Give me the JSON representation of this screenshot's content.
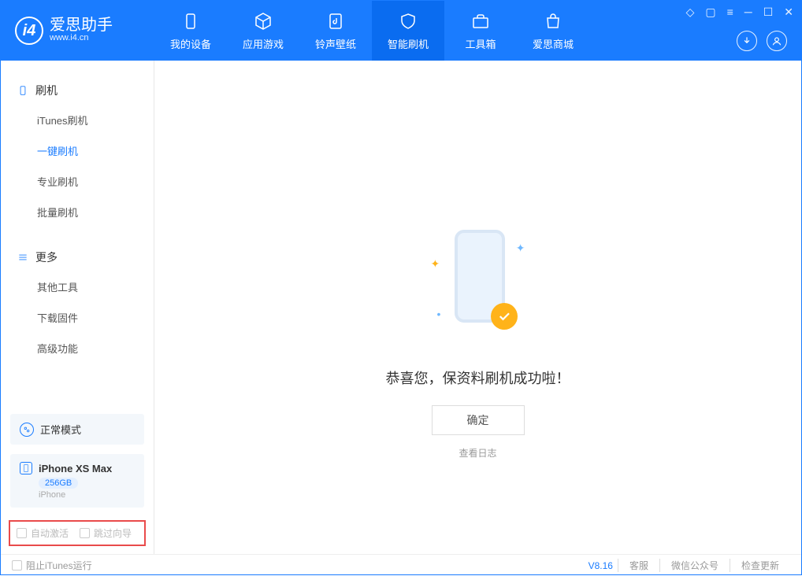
{
  "app": {
    "name": "爱思助手",
    "url": "www.i4.cn"
  },
  "tabs": [
    {
      "label": "我的设备"
    },
    {
      "label": "应用游戏"
    },
    {
      "label": "铃声壁纸"
    },
    {
      "label": "智能刷机",
      "active": true
    },
    {
      "label": "工具箱"
    },
    {
      "label": "爱思商城"
    }
  ],
  "sidebar": {
    "section1": {
      "title": "刷机",
      "items": [
        "iTunes刷机",
        "一键刷机",
        "专业刷机",
        "批量刷机"
      ],
      "activeIndex": 1
    },
    "section2": {
      "title": "更多",
      "items": [
        "其他工具",
        "下载固件",
        "高级功能"
      ]
    },
    "modeCard": "正常模式",
    "device": {
      "name": "iPhone XS Max",
      "storage": "256GB",
      "type": "iPhone"
    },
    "checkbox1": "自动激活",
    "checkbox2": "跳过向导"
  },
  "main": {
    "message": "恭喜您，保资料刷机成功啦！",
    "okBtn": "确定",
    "logLink": "查看日志"
  },
  "footer": {
    "blockItunes": "阻止iTunes运行",
    "version": "V8.16",
    "links": [
      "客服",
      "微信公众号",
      "检查更新"
    ]
  }
}
